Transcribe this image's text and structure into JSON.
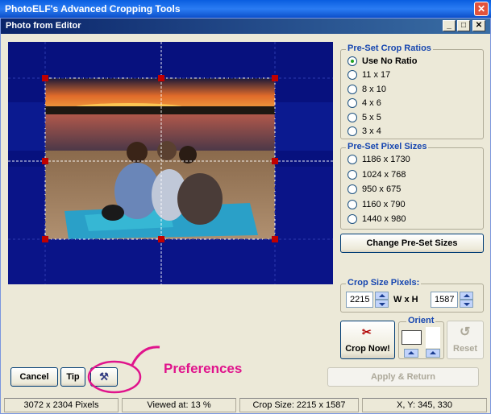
{
  "app_title": "PhotoELF's Advanced Cropping Tools",
  "outer_close": "✕",
  "inner_title": "Photo from Editor",
  "inner_buttons": {
    "minimize": "_",
    "maximize": "□",
    "close": "✕"
  },
  "preset_ratios": {
    "title": "Pre-Set Crop Ratios",
    "options": [
      {
        "label": "Use No Ratio",
        "checked": true
      },
      {
        "label": "11 x 17",
        "checked": false
      },
      {
        "label": "8 x 10",
        "checked": false
      },
      {
        "label": "4 x 6",
        "checked": false
      },
      {
        "label": "5 x 5",
        "checked": false
      },
      {
        "label": "3 x 4",
        "checked": false
      }
    ]
  },
  "preset_pixels": {
    "title": "Pre-Set Pixel Sizes",
    "options": [
      {
        "label": "1186 x 1730",
        "checked": false
      },
      {
        "label": "1024 x 768",
        "checked": false
      },
      {
        "label": "950 x 675",
        "checked": false
      },
      {
        "label": "1160 x 790",
        "checked": false
      },
      {
        "label": "1440 x 980",
        "checked": false
      }
    ]
  },
  "change_presets_label": "Change Pre-Set Sizes",
  "crop_size": {
    "title": "Crop Size Pixels:",
    "width": "2215",
    "sep": "W x H",
    "height": "1587"
  },
  "orient_title": "Orient",
  "crop_now_label": "Crop Now!",
  "reset_label": "Reset",
  "cancel_label": "Cancel",
  "tip_label": "Tip",
  "apply_label": "Apply & Return",
  "callout": "Preferences",
  "status": {
    "pixels": "3072 x 2304 Pixels",
    "viewed": "Viewed at: 13 %",
    "crop_size": "Crop Size: 2215 x 1587",
    "xy": "X, Y: 345, 330"
  },
  "colors": {
    "accent_callout": "#e0148c",
    "photo_bg": "#06107a",
    "handle": "#c00000"
  },
  "icons": [
    "close-icon",
    "minimize-icon",
    "maximize-icon",
    "scissors-icon",
    "hammer-icon",
    "reset-icon",
    "spin-up-icon",
    "spin-down-icon"
  ]
}
